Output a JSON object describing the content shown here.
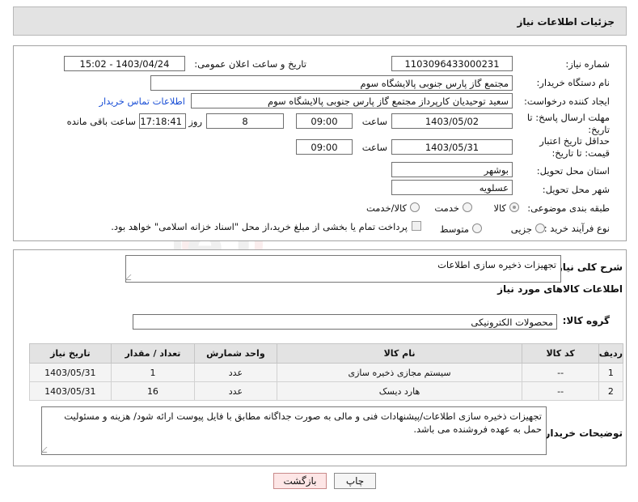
{
  "header": {
    "title": "جزئیات اطلاعات نیاز"
  },
  "fields": {
    "need_number_label": "شماره نیاز:",
    "need_number": "1103096433000231",
    "announce_label": "تاریخ و ساعت اعلان عمومی:",
    "announce_value": "1403/04/24 - 15:02",
    "buyer_org_label": "نام دستگاه خریدار:",
    "buyer_org": "مجتمع گاز پارس جنوبی  پالایشگاه سوم",
    "requester_label": "ایجاد کننده درخواست:",
    "requester": "سعید توحیدیان کارپرداز مجتمع گاز پارس جنوبی  پالایشگاه سوم",
    "buyer_contact_link": "اطلاعات تماس خریدار",
    "reply_deadline_label": "مهلت ارسال پاسخ: تا تاریخ:",
    "reply_date": "1403/05/02",
    "time_label": "ساعت",
    "reply_time": "09:00",
    "days_count": "8",
    "days_and_label": "روز و",
    "remaining_time": "17:18:41",
    "remaining_label": "ساعت باقی مانده",
    "price_validity_label": "حداقل تاریخ اعتبار قیمت: تا تاریخ:",
    "validity_date": "1403/05/31",
    "validity_time": "09:00",
    "province_label": "استان محل تحویل:",
    "province": "بوشهر",
    "city_label": "شهر محل تحویل:",
    "city": "عسلویه",
    "category_label": "طبقه بندی موضوعی:",
    "cat_goods": "کالا",
    "cat_service": "خدمت",
    "cat_goods_service": "کالا/خدمت",
    "purchase_type_label": "نوع فرآیند خرید :",
    "type_partial": "جزیی",
    "type_medium": "متوسط",
    "payment_note": "پرداخت تمام یا بخشی از مبلغ خرید،از محل \"اسناد خزانه اسلامی\" خواهد بود."
  },
  "summary": {
    "label": "شرح کلی نیاز:",
    "value": "تجهیزات ذخیره سازی اطلاعات",
    "goods_info_title": "اطلاعات کالاهای مورد نیاز",
    "group_label": "گروه کالا:",
    "group_value": "محصولات الکترونیکی"
  },
  "table": {
    "headers": [
      "ردیف",
      "کد کالا",
      "نام کالا",
      "واحد شمارش",
      "تعداد / مقدار",
      "تاریخ نیاز"
    ],
    "rows": [
      [
        "1",
        "--",
        "سیستم مجازی ذخیره سازی",
        "عدد",
        "1",
        "1403/05/31"
      ],
      [
        "2",
        "--",
        "هارد دیسک",
        "عدد",
        "16",
        "1403/05/31"
      ]
    ]
  },
  "buyer_notes": {
    "label": "توضیحات خریدار:",
    "value": "تجهیزات ذخیره سازی اطلاعات/پیشنهادات فنی و مالی به صورت جداگانه مطابق با فایل پیوست ارائه شود/ هزینه و مسئولیت حمل به عهده فروشنده می باشد."
  },
  "buttons": {
    "print": "چاپ",
    "back": "بازگشت"
  },
  "watermark": {
    "text": "AriaTender.neT"
  }
}
